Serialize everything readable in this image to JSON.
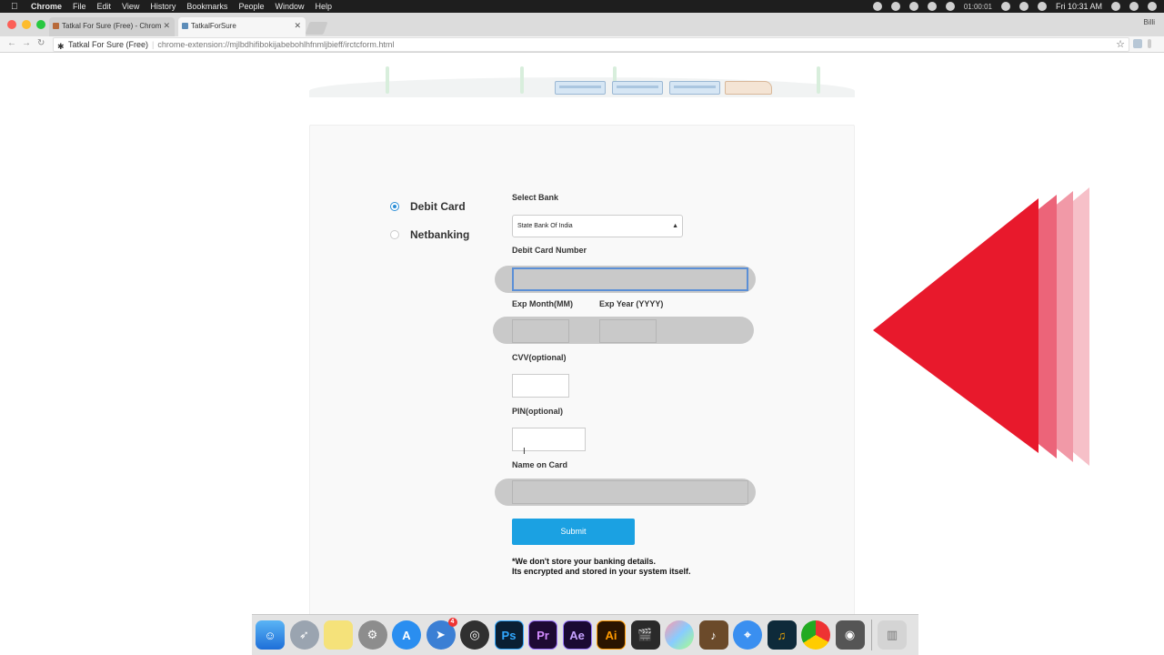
{
  "menubar": {
    "apple": "",
    "app_name": "Chrome",
    "menus": [
      "File",
      "Edit",
      "View",
      "History",
      "Bookmarks",
      "People",
      "Window",
      "Help"
    ],
    "timer": "01:00:01",
    "clock": "Fri 10:31 AM"
  },
  "tabs": [
    {
      "title": "Tatkal For Sure (Free) - Chrom",
      "active": false
    },
    {
      "title": "TatkalForSure",
      "active": true
    }
  ],
  "profile_name": "Billi",
  "address_bar": {
    "extension_name": "Tatkal For Sure (Free)",
    "url": "chrome-extension://mjlbdhifibokijabebohlhfnmljbieff/irctcform.html"
  },
  "form": {
    "payment_options": [
      {
        "label": "Debit Card",
        "checked": true
      },
      {
        "label": "Netbanking",
        "checked": false
      }
    ],
    "select_bank_label": "Select Bank",
    "selected_bank": "State Bank Of India",
    "debit_card_number_label": "Debit Card Number",
    "exp_month_label": "Exp Month(MM)",
    "exp_year_label": "Exp Year (YYYY)",
    "cvv_label": "CVV(optional)",
    "pin_label": "PIN(optional)",
    "name_on_card_label": "Name on Card",
    "submit_label": "Submit",
    "note_line1": "*We don't store your banking details.",
    "note_line2": "Its encrypted and stored in your system itself."
  },
  "colors": {
    "accent": "#1ba1e2",
    "radio_checked": "#2b8ed6",
    "overlay_red": "#e8192c"
  },
  "dock": {
    "icons": [
      "finder-icon",
      "launchpad-icon",
      "stickies-icon",
      "system-preferences-icon",
      "app-store-icon",
      "telegram-icon",
      "obs-icon",
      "photoshop-icon",
      "premiere-icon",
      "after-effects-icon",
      "illustrator-icon",
      "final-cut-icon",
      "motion-icon",
      "logic-icon",
      "safari-icon",
      "audition-icon",
      "chrome-icon",
      "gamepad-icon",
      "trash-icon"
    ],
    "labels": {
      "photoshop": "Ps",
      "premiere": "Pr",
      "after_effects": "Ae",
      "illustrator": "Ai"
    },
    "telegram_badge": "4"
  }
}
